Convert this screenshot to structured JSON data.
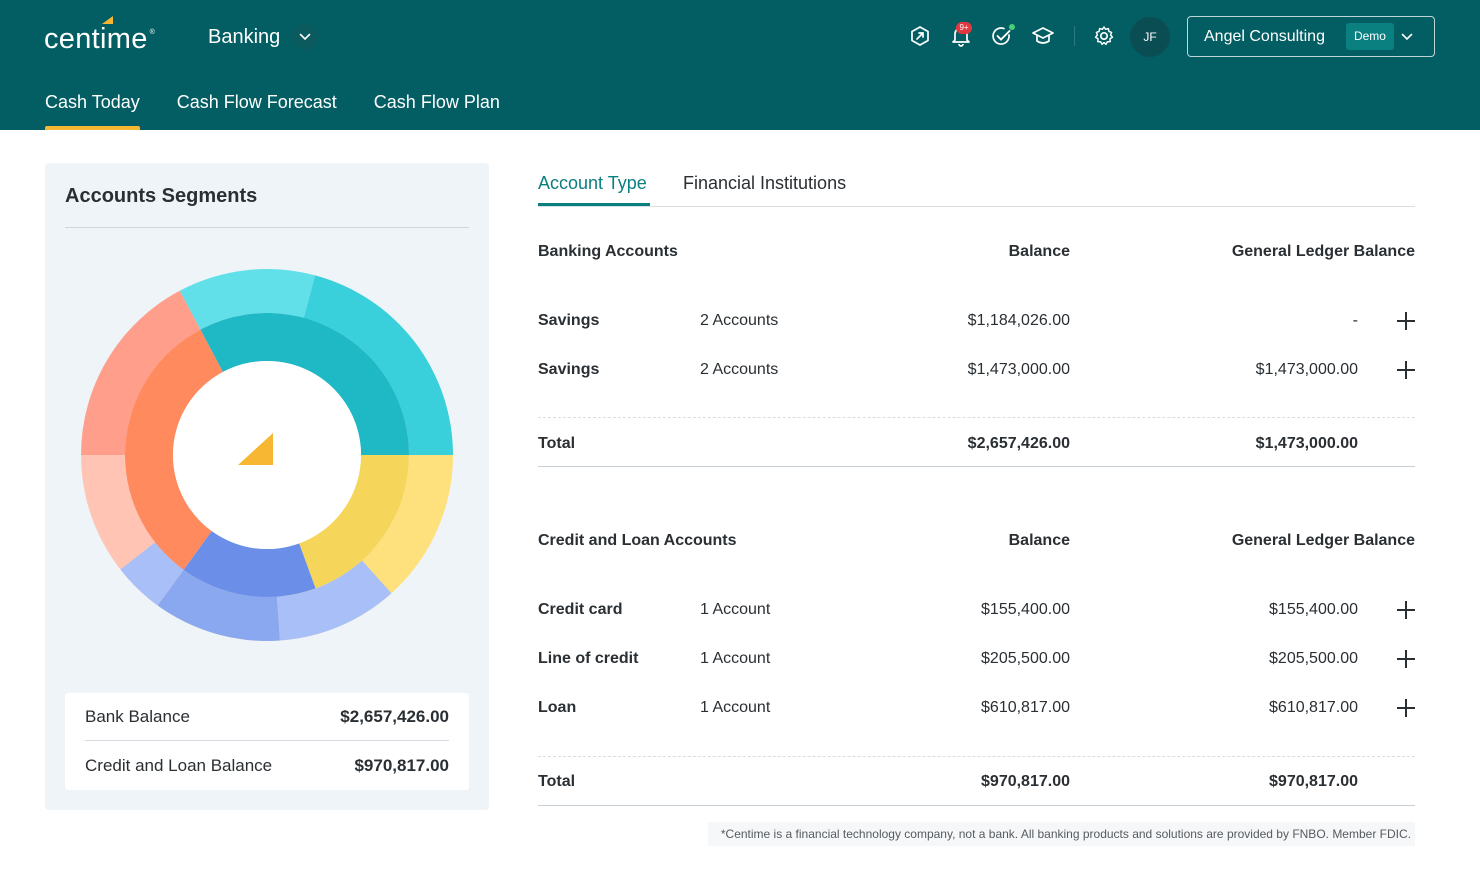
{
  "header": {
    "logo_text": "centime",
    "logo_tm": "®",
    "module": "Banking",
    "avatar_initials": "JF",
    "notification_badge": "9+",
    "company": "Angel Consulting",
    "company_tag": "Demo",
    "icons": [
      "insights-icon",
      "bell-icon",
      "task-check-icon",
      "graduation-cap-icon",
      "gear-icon"
    ]
  },
  "nav": {
    "tabs": [
      "Cash Today",
      "Cash Flow Forecast",
      "Cash Flow Plan"
    ],
    "active": "Cash Today"
  },
  "segments": {
    "title": "Accounts Segments",
    "chart_data": {
      "type": "donut",
      "rings": [
        "inner",
        "outer"
      ],
      "groups": [
        {
          "color_inner": "#1fb9c6",
          "color_outer": [
            "#62e0ea",
            "#39cfdb"
          ]
        },
        {
          "color_inner": "#f5d55a",
          "color_outer": [
            "#fee07c"
          ]
        },
        {
          "color_inner": "#6b8fe8",
          "color_outer": [
            "#8aa8f0",
            "#a8c0f7"
          ]
        },
        {
          "color_inner": "#ff8a5e",
          "color_outer": [
            "#ffc4b4",
            "#ff9f8b"
          ]
        }
      ],
      "center_icon": "centime-logo-mark-icon"
    },
    "balances": [
      {
        "label": "Bank Balance",
        "value": "$2,657,426.00"
      },
      {
        "label": "Credit and Loan Balance",
        "value": "$970,817.00"
      }
    ]
  },
  "subtabs": [
    "Account Type",
    "Financial Institutions"
  ],
  "banking": {
    "heading": "Banking Accounts",
    "col_balance": "Balance",
    "col_gl": "General Ledger Balance",
    "rows": [
      {
        "name": "Savings",
        "accounts": "2 Accounts",
        "balance": "$1,184,026.00",
        "gl": "-"
      },
      {
        "name": "Savings",
        "accounts": "2 Accounts",
        "balance": "$1,473,000.00",
        "gl": "$1,473,000.00"
      }
    ],
    "total_label": "Total",
    "total_balance": "$2,657,426.00",
    "total_gl": "$1,473,000.00"
  },
  "credit": {
    "heading": "Credit and Loan Accounts",
    "col_balance": "Balance",
    "col_gl": "General Ledger Balance",
    "rows": [
      {
        "name": "Credit card",
        "accounts": "1 Account",
        "balance": "$155,400.00",
        "gl": "$155,400.00"
      },
      {
        "name": "Line of credit",
        "accounts": "1 Account",
        "balance": "$205,500.00",
        "gl": "$205,500.00"
      },
      {
        "name": "Loan",
        "accounts": "1 Account",
        "balance": "$610,817.00",
        "gl": "$610,817.00"
      }
    ],
    "total_label": "Total",
    "total_balance": "$970,817.00",
    "total_gl": "$970,817.00"
  },
  "footnote": "*Centime is a financial technology company, not a bank. All banking products and solutions are provided by FNBO. Member FDIC."
}
